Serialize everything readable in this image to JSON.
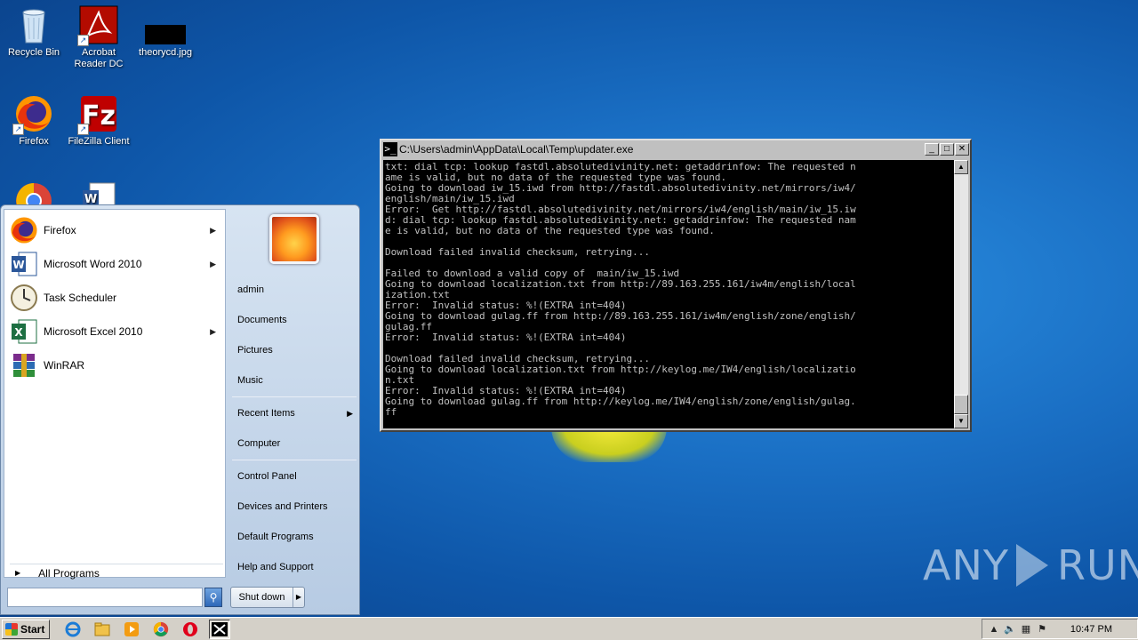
{
  "desktop": {
    "icons": [
      {
        "label": "Recycle Bin",
        "icon": "recycle-bin-icon"
      },
      {
        "label": "Acrobat Reader DC",
        "icon": "acrobat-icon"
      },
      {
        "label": "theorycd.jpg",
        "icon": "image-file-icon"
      },
      {
        "label": "Firefox",
        "icon": "firefox-icon"
      },
      {
        "label": "FileZilla Client",
        "icon": "filezilla-icon"
      }
    ]
  },
  "console": {
    "title": "C:\\Users\\admin\\AppData\\Local\\Temp\\updater.exe",
    "text": "txt: dial tcp: lookup fastdl.absolutedivinity.net: getaddrinfow: The requested n\name is valid, but no data of the requested type was found.\nGoing to download iw_15.iwd from http://fastdl.absolutedivinity.net/mirrors/iw4/\nenglish/main/iw_15.iwd\nError:  Get http://fastdl.absolutedivinity.net/mirrors/iw4/english/main/iw_15.iw\nd: dial tcp: lookup fastdl.absolutedivinity.net: getaddrinfow: The requested nam\ne is valid, but no data of the requested type was found.\n\nDownload failed invalid checksum, retrying...\n\nFailed to download a valid copy of  main/iw_15.iwd\nGoing to download localization.txt from http://89.163.255.161/iw4m/english/local\nization.txt\nError:  Invalid status: %!(EXTRA int=404)\nGoing to download gulag.ff from http://89.163.255.161/iw4m/english/zone/english/\ngulag.ff\nError:  Invalid status: %!(EXTRA int=404)\n\nDownload failed invalid checksum, retrying...\nGoing to download localization.txt from http://keylog.me/IW4/english/localizatio\nn.txt\nError:  Invalid status: %!(EXTRA int=404)\nGoing to download gulag.ff from http://keylog.me/IW4/english/zone/english/gulag.\nff"
  },
  "start_menu": {
    "programs": [
      {
        "label": "Firefox",
        "has_submenu": true
      },
      {
        "label": "Microsoft Word 2010",
        "has_submenu": true
      },
      {
        "label": "Task Scheduler",
        "has_submenu": false
      },
      {
        "label": "Microsoft Excel 2010",
        "has_submenu": true
      },
      {
        "label": "WinRAR",
        "has_submenu": false
      }
    ],
    "all_programs": "All Programs",
    "search_placeholder": "",
    "right_links": [
      {
        "label": "admin"
      },
      {
        "label": "Documents"
      },
      {
        "label": "Pictures"
      },
      {
        "label": "Music"
      },
      {
        "label": "Recent Items",
        "has_submenu": true
      },
      {
        "label": "Computer"
      },
      {
        "label": "Control Panel"
      },
      {
        "label": "Devices and Printers"
      },
      {
        "label": "Default Programs"
      },
      {
        "label": "Help and Support"
      }
    ],
    "shutdown_label": "Shut down"
  },
  "taskbar": {
    "start_label": "Start",
    "clock": "10:47 PM"
  },
  "watermark": {
    "left": "ANY",
    "right": "RUN"
  },
  "colors": {
    "desktop": "#1a6fc4",
    "console_bg": "#000000",
    "console_fg": "#c0c0c0"
  }
}
